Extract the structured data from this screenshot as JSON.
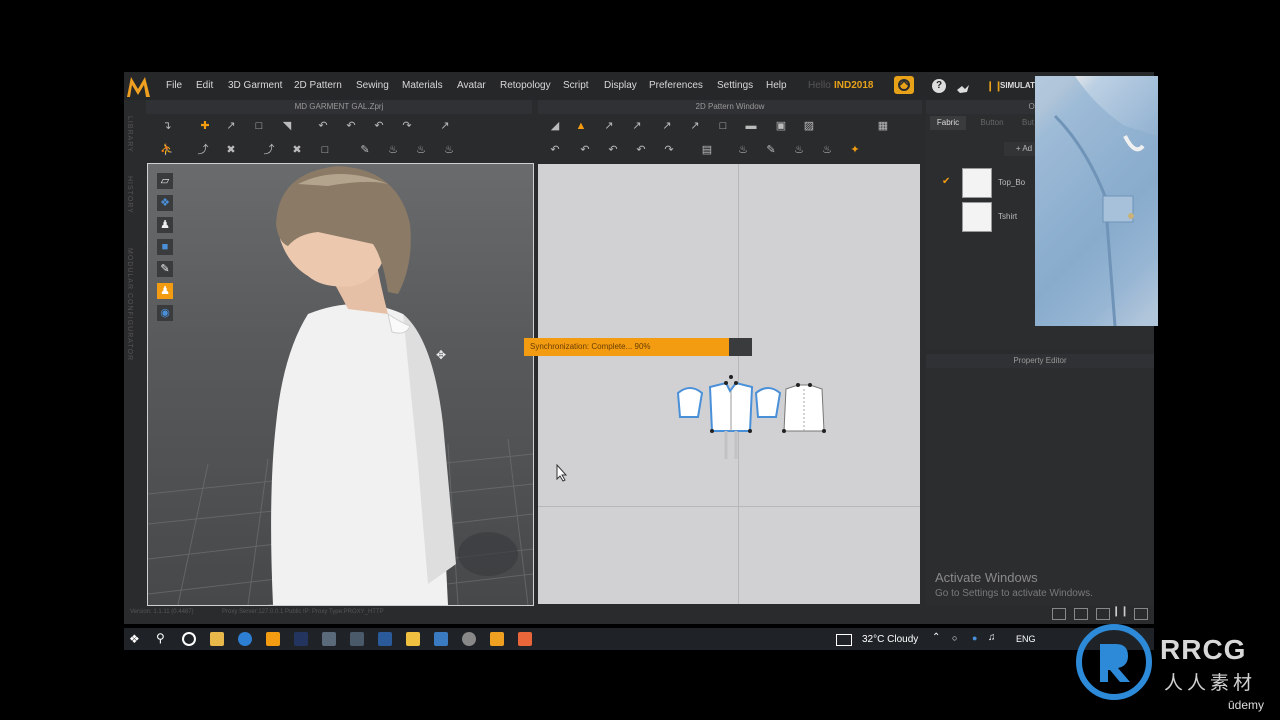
{
  "app": {
    "menu": [
      "File",
      "Edit",
      "3D Garment",
      "2D Pattern",
      "Sewing",
      "Materials",
      "Avatar",
      "Retopology",
      "Script",
      "Display",
      "Preferences",
      "Settings",
      "Help"
    ],
    "hello": "Hello",
    "user": "IND2018",
    "simulation_label": "SIMULAT",
    "left_side_labels": [
      "LIBRARY",
      "HISTORY",
      "MODULAR CONFIGURATOR"
    ]
  },
  "windows": {
    "garment_title": "MD GARMENT GAL.Zprj",
    "pattern_title": "2D Pattern Window",
    "object_title": "Object",
    "property_title": "Property Editor"
  },
  "object_browser": {
    "tabs": [
      "Fabric",
      "Button",
      "But"
    ],
    "add_label": "+ Ad",
    "items": [
      {
        "name": "Top_Bo",
        "checked": true
      },
      {
        "name": "Tshirt",
        "checked": false
      }
    ]
  },
  "sync": {
    "text": "Synchronization: Complete... 90%",
    "progress": 0.9
  },
  "status": {
    "version": "Version: 1.1.11 (0.4487)",
    "proxy": "Proxy Server:127.0.0.1   Public IP:   Proxy Type:PROXY_HTTP"
  },
  "activate_windows": {
    "title": "Activate Windows",
    "subtitle": "Go to Settings to activate Windows."
  },
  "taskbar": {
    "weather": "32°C  Cloudy",
    "lang": "ENG"
  },
  "overlay": {
    "watermark_text": "RRCG",
    "watermark_sub": "人人素材",
    "udemy": "ūdemy"
  },
  "colors": {
    "accent": "#f39c12",
    "brand_orange": "#e8a21a",
    "panel_bg": "#2a2b2d",
    "selection_blue": "#4a90d9"
  }
}
